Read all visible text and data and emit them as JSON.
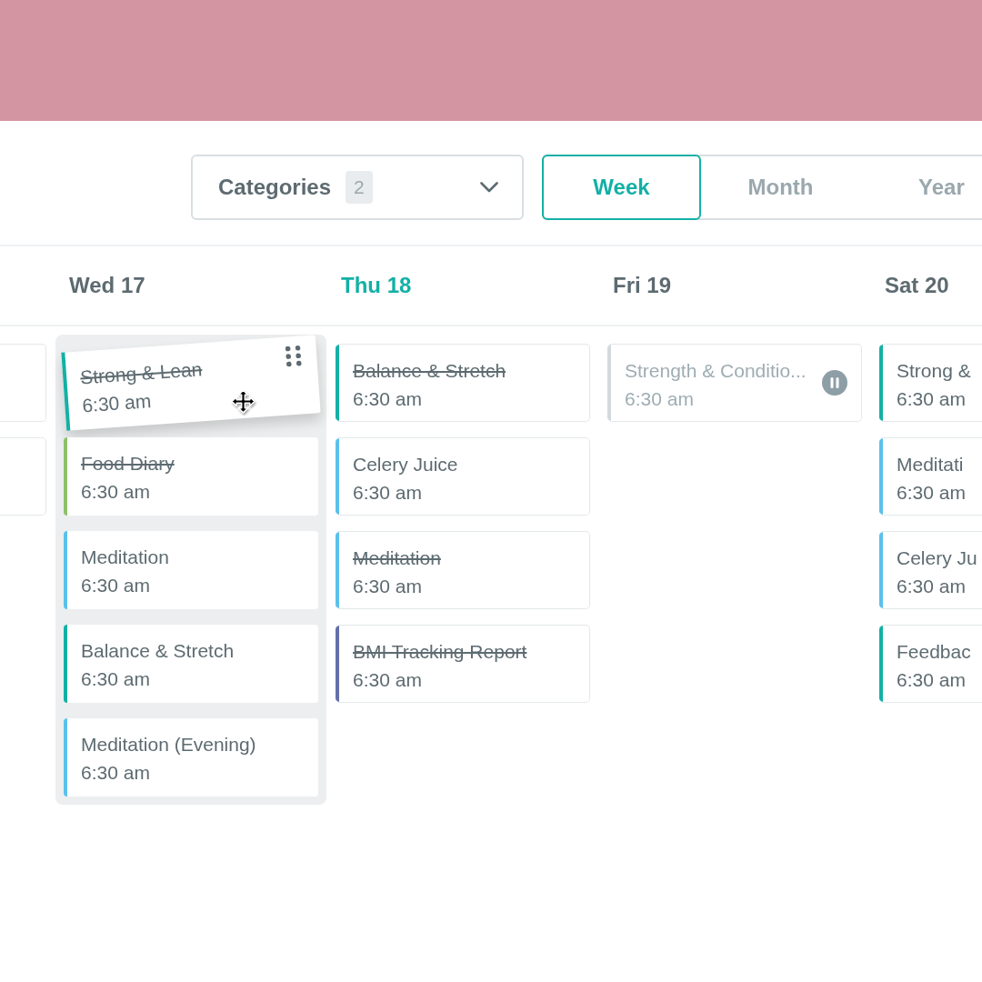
{
  "categories": {
    "label": "Categories",
    "count": "2"
  },
  "views": [
    {
      "label": "Week",
      "selected": true
    },
    {
      "label": "Month",
      "selected": false
    },
    {
      "label": "Year",
      "selected": false
    }
  ],
  "days": [
    {
      "kind": "cut_left",
      "events": [
        {
          "kind": "clipped"
        },
        {
          "kind": "clipped"
        }
      ]
    },
    {
      "kind": "full",
      "label": "Wed 17",
      "today": false,
      "drop_target": true,
      "events": [
        {
          "kind": "dragged",
          "title": "Strong & Lean",
          "time": "6:30 am",
          "done": true,
          "color": "#13b0a5"
        },
        {
          "kind": "task",
          "title": "Food Diary",
          "time": "6:30 am",
          "done": true,
          "color": "#8cc06a"
        },
        {
          "kind": "task",
          "title": "Meditation",
          "time": "6:30 am",
          "done": false,
          "color": "#5bc0eb"
        },
        {
          "kind": "task",
          "title": "Balance & Stretch",
          "time": "6:30 am",
          "done": false,
          "color": "#13b0a5"
        },
        {
          "kind": "task",
          "title": "Meditation (Evening)",
          "time": "6:30 am",
          "done": false,
          "color": "#5bc0eb"
        }
      ]
    },
    {
      "kind": "full",
      "label": "Thu 18",
      "today": true,
      "drop_target": false,
      "events": [
        {
          "kind": "task",
          "title": "Balance & Stretch",
          "time": "6:30 am",
          "done": true,
          "color": "#13b0a5"
        },
        {
          "kind": "task",
          "title": "Celery Juice",
          "time": "6:30 am",
          "done": false,
          "color": "#5bc0eb"
        },
        {
          "kind": "task",
          "title": "Meditation",
          "time": "6:30 am",
          "done": true,
          "color": "#5bc0eb"
        },
        {
          "kind": "task",
          "title": "BMI Tracking Report",
          "time": "6:30 am",
          "done": true,
          "color": "#6470a8"
        }
      ]
    },
    {
      "kind": "full",
      "label": "Fri 19",
      "today": false,
      "drop_target": false,
      "events": [
        {
          "kind": "paused",
          "title": "Strength & Conditio...",
          "time": "6:30 am",
          "done": false,
          "color": "#d3dadd"
        }
      ]
    },
    {
      "kind": "cut_right",
      "label": "Sat 20",
      "today": false,
      "drop_target": false,
      "events": [
        {
          "kind": "task",
          "title": "Strong &",
          "time": "6:30 am",
          "done": false,
          "color": "#13b0a5"
        },
        {
          "kind": "task",
          "title": "Meditati",
          "time": "6:30 am",
          "done": false,
          "color": "#5bc0eb"
        },
        {
          "kind": "task",
          "title": "Celery Ju",
          "time": "6:30 am",
          "done": false,
          "color": "#5bc0eb"
        },
        {
          "kind": "task",
          "title": "Feedbac",
          "time": "6:30 am",
          "done": false,
          "color": "#13b0a5"
        }
      ]
    }
  ]
}
